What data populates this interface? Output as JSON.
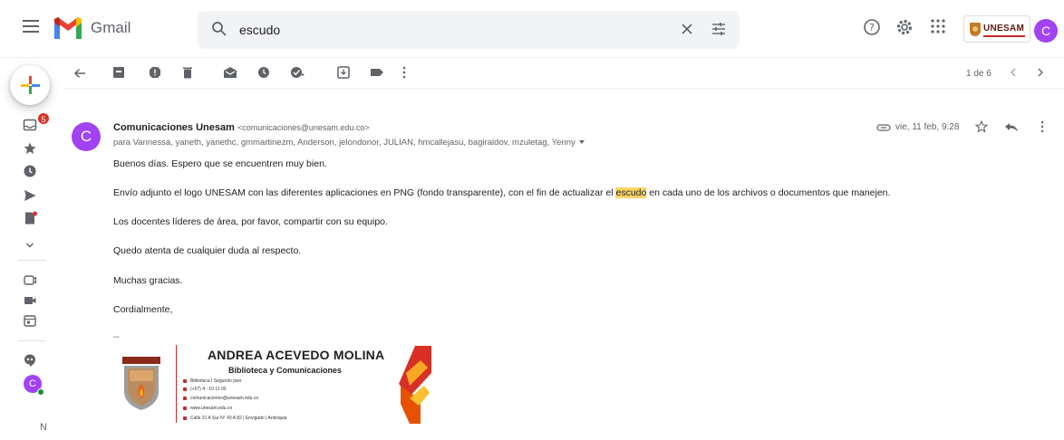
{
  "app": {
    "brand": "Gmail"
  },
  "search": {
    "query": "escudo"
  },
  "org": {
    "label": "UNESAM"
  },
  "user": {
    "initial": "C"
  },
  "rail": {
    "unread_badge": "5",
    "footer_letter": "N"
  },
  "toolbar": {
    "icons": [
      "back-icon",
      "archive-icon",
      "report-spam-icon",
      "delete-icon",
      "mark-unread-icon",
      "snooze-icon",
      "add-to-tasks-icon",
      "move-to-icon",
      "label-icon",
      "more-icon"
    ],
    "pager": "1 de 6"
  },
  "message": {
    "sender_initial": "C",
    "sender_name": "Comunicaciones Unesam",
    "sender_email": "<comunicaciones@unesam.edu.co>",
    "recipients": "para Vannessa, yaneth, yanethc, gmmartinezm, Anderson, jelondonor, JULIAN, hmcallejasu, bagiraldov, mzuletag, Yenny",
    "date": "vie, 11 feb, 9:28",
    "lines": {
      "greeting": "Buenos días. Espero que se encuentren muy bien.",
      "p2_before": "Envío adjunto el logo UNESAM con las diferentes aplicaciones en PNG (fondo transparente), con el fin de actualizar el ",
      "p2_highlight": "escudo",
      "p2_after": " en cada uno de los archivos o documentos que manejen.",
      "p3": "Los docentes líderes de área, por favor, compartir con su equipo.",
      "p4": "Quedo atenta de cualquier duda al respecto.",
      "p5": "Muchas gracias.",
      "p6": "Cordialmente,",
      "dash": "--"
    }
  },
  "signature": {
    "name": "ANDREA ACEVEDO MOLINA",
    "role": "Biblioteca y Comunicaciones",
    "rows": [
      "Biblioteca | Segundo piso",
      "(+57) 4 - 10 11 00",
      "comunicaciones@unesam.edu.co",
      "www.unesam.edu.co",
      "Calle 31 A Sur N° 43 A 82 | Envigado | Antioquia"
    ]
  },
  "colors": {
    "accent": "#a142f4",
    "highlight": "#fdd663",
    "brand_red": "#c62828"
  }
}
